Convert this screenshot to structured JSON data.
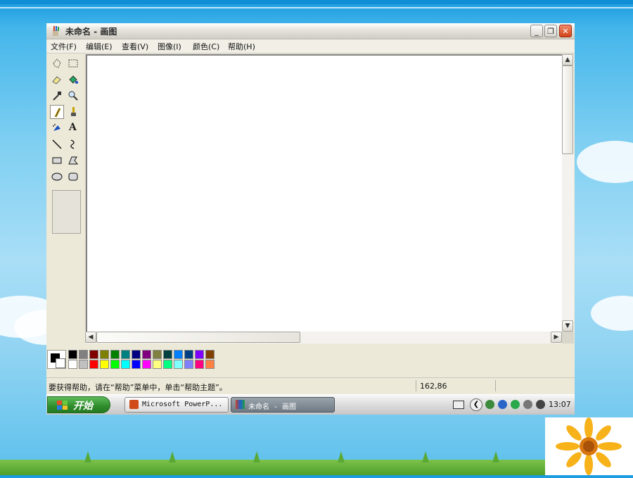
{
  "window": {
    "title": "未命名 - 画图",
    "controls": {
      "minimize": "_",
      "restore": "❐",
      "close": "✕"
    }
  },
  "menu": [
    "文件(F)",
    "编辑(E)",
    "查看(V)",
    "图像(I)",
    "颜色(C)",
    "帮助(H)"
  ],
  "tools": [
    {
      "name": "free-form-select-icon"
    },
    {
      "name": "rect-select-icon"
    },
    {
      "name": "eraser-icon"
    },
    {
      "name": "fill-bucket-icon"
    },
    {
      "name": "color-picker-icon"
    },
    {
      "name": "magnifier-icon"
    },
    {
      "name": "pencil-icon",
      "selected": true
    },
    {
      "name": "brush-icon"
    },
    {
      "name": "airbrush-icon"
    },
    {
      "name": "text-icon",
      "glyph": "A"
    },
    {
      "name": "line-icon"
    },
    {
      "name": "curve-icon"
    },
    {
      "name": "rectangle-icon"
    },
    {
      "name": "polygon-icon"
    },
    {
      "name": "ellipse-icon"
    },
    {
      "name": "rounded-rect-icon"
    }
  ],
  "palette": {
    "foreground": "#000000",
    "background": "#ffffff",
    "row1": [
      "#000000",
      "#808080",
      "#800000",
      "#808000",
      "#008000",
      "#008080",
      "#000080",
      "#800080",
      "#808040",
      "#004040",
      "#0080ff",
      "#004080",
      "#8000ff",
      "#804000"
    ],
    "row2": [
      "#ffffff",
      "#c0c0c0",
      "#ff0000",
      "#ffff00",
      "#00ff00",
      "#00ffff",
      "#0000ff",
      "#ff00ff",
      "#ffff80",
      "#00ff80",
      "#80ffff",
      "#8080ff",
      "#ff0080",
      "#ff8040"
    ]
  },
  "status": {
    "help_text": "要获得帮助，请在“帮助”菜单中，单击“帮助主题”。",
    "coords": "162,86"
  },
  "taskbar": {
    "start_label": "开始",
    "tasks": [
      {
        "label": "Microsoft PowerP...",
        "active": false
      },
      {
        "label": "未命名 - 画图",
        "active": true
      }
    ],
    "clock": "13:07"
  }
}
